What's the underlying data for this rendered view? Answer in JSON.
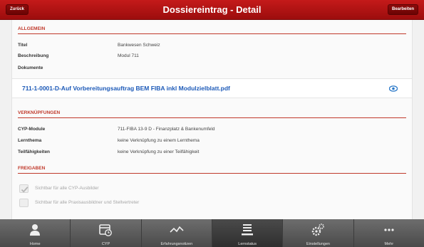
{
  "header": {
    "title": "Dossiereintrag - Detail",
    "back_label": "Zurück",
    "edit_label": "Bearbeiten"
  },
  "allgemein": {
    "heading": "ALLGEMEIN",
    "rows": [
      {
        "label": "Titel",
        "value": "Bankwesen Schweiz"
      },
      {
        "label": "Beschreibung",
        "value": "Modul 711"
      },
      {
        "label": "Dokumente",
        "value": ""
      }
    ],
    "document": {
      "name": "711-1-0001-D-Auf Vorbereitungsauftrag BEM FIBA inkl Modulzielblatt.pdf",
      "icon": "eye-icon"
    }
  },
  "verknuepfungen": {
    "heading": "VERKNÜPFUNGEN",
    "rows": [
      {
        "label": "CYP-Module",
        "value": "711-FIBA 13-9 D - Finanzplatz & Bankenumfeld"
      },
      {
        "label": "Lernthema",
        "value": "keine Verknüpfung zu einem Lernthema"
      },
      {
        "label": "Teilfähigkeiten",
        "value": "keine Verknüpfung zu einer Teilfähigkeit"
      }
    ]
  },
  "freigaben": {
    "heading": "FREIGABEN",
    "options": [
      {
        "label": "Sichtbar für alle CYP-Ausbilder",
        "checked": true
      },
      {
        "label": "Sichtbar für alle Praxisausbildner und Stellvertreter",
        "checked": false
      }
    ]
  },
  "tabs": [
    {
      "label": "Home",
      "icon": "person-icon"
    },
    {
      "label": "CYP",
      "icon": "calendar-clock-icon"
    },
    {
      "label": "Erfahrungsnotizen",
      "icon": "trend-line-icon"
    },
    {
      "label": "Lernstatus",
      "icon": "list-icon",
      "active": true
    },
    {
      "label": "Einstellungen",
      "icon": "gears-icon"
    },
    {
      "label": "Mehr",
      "icon": "more-dots-icon"
    }
  ],
  "colors": {
    "header": "#b01414",
    "accent": "#c0392b",
    "link": "#1d5ab8",
    "tabbar": "#555555"
  }
}
